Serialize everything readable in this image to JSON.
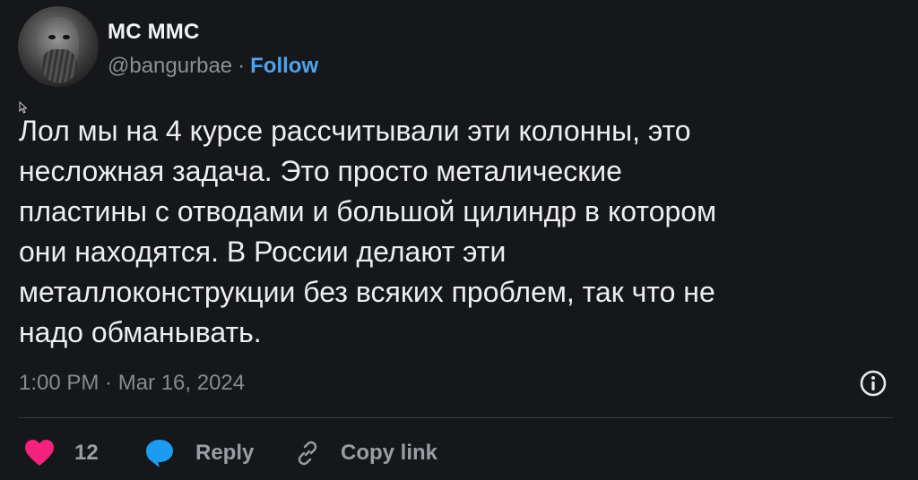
{
  "author": {
    "name": "МС ММС",
    "handle": "@bangurbae",
    "separator": "·",
    "follow_label": "Follow"
  },
  "tweet": {
    "lines": [
      "Лол мы на 4 курсе рассчитывали эти колонны, это",
      "несложная задача. Это просто металические",
      "пластины с отводами и большой цилиндр в котором",
      "они находятся. В России делают эти",
      "металлоконструкции без всяких проблем, так что не",
      "надо обманывать."
    ],
    "timestamp": "1:00 PM · Mar 16, 2024"
  },
  "actions": {
    "like_count": "12",
    "reply_label": "Reply",
    "copy_label": "Copy link"
  },
  "icons": {
    "avatar": "avatar-photo",
    "info": "info-icon",
    "like": "heart-icon",
    "reply": "speech-bubble-icon",
    "copy": "link-icon",
    "cursor": "mouse-cursor-icon"
  },
  "colors": {
    "background": "#16171a",
    "follow": "#4ea3f0",
    "heart": "#f4227d",
    "reply_bubble": "#1d9bf0",
    "muted": "#868a90"
  }
}
